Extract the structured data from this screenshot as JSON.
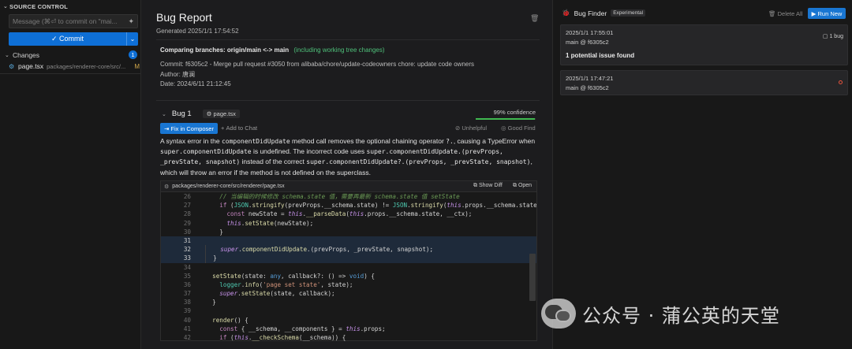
{
  "source_control": {
    "header": "SOURCE CONTROL",
    "message_placeholder": "Message (⌘⏎ to commit on \"mai...",
    "commit_label": "Commit",
    "changes_label": "Changes",
    "changes_count": "1",
    "file_name": "page.tsx",
    "file_path": "packages/renderer-core/src/...",
    "file_status": "M"
  },
  "report": {
    "title": "Bug Report",
    "generated": "Generated 2025/1/1 17:54:52",
    "comparing": "Comparing branches: origin/main <-> main",
    "comparing_note": "(including working tree changes)",
    "commit": "Commit: f6305c2 - Merge pull request #3050 from alibaba/chore/update-codeowners chore: update code owners",
    "author": "Author: 唐澜",
    "date": "Date: 2024/6/11 21:12:45",
    "bug_title": "Bug 1",
    "bug_file": "page.tsx",
    "confidence": "99% confidence",
    "confidence_value": 0.99,
    "fix_label": "Fix in Composer",
    "add_chat_label": "Add to Chat",
    "unhelpful_label": "Unhelpful",
    "good_find_label": "Good Find",
    "desc": {
      "p1": "A syntax error in the ",
      "c1": "componentDidUpdate",
      "p2": " method call removes the optional chaining operator ",
      "c2": "?.",
      "p3": ", causing a TypeError when ",
      "c3": "super.componentDidUpdate",
      "p4": " is undefined. The incorrect code uses ",
      "c4": "super.componentDidUpdate.(prevProps, _prevState, snapshot)",
      "p5": " instead of the correct ",
      "c5": "super.componentDidUpdate?.(prevProps, _prevState, snapshot)",
      "p6": ", which will throw an error if the method is not defined on the superclass."
    },
    "viewer_path": "packages/renderer-core/src/renderer/page.tsx",
    "show_diff_label": "Show Diff",
    "open_label": "Open"
  },
  "code_lines": [
    {
      "n": "26",
      "text": "    // 当编辑的时候修改 schema.state 值，需要再最新 schema.state 值 setState"
    },
    {
      "n": "27",
      "text": "    if (JSON.stringify(prevProps.__schema.state) != JSON.stringify(this.props.__schema.state)) {"
    },
    {
      "n": "28",
      "text": "      const newState = this.__parseData(this.props.__schema.state, __ctx);"
    },
    {
      "n": "29",
      "text": "      this.setState(newState);"
    },
    {
      "n": "30",
      "text": "    }"
    },
    {
      "n": "31",
      "text": ""
    },
    {
      "n": "32",
      "text": "    super.componentDidUpdate.(prevProps, _prevState, snapshot);"
    },
    {
      "n": "33",
      "text": "  }"
    },
    {
      "n": "34",
      "text": ""
    },
    {
      "n": "35",
      "text": "  setState(state: any, callback?: () => void) {"
    },
    {
      "n": "36",
      "text": "    logger.info('page set state', state);"
    },
    {
      "n": "37",
      "text": "    super.setState(state, callback);"
    },
    {
      "n": "38",
      "text": "  }"
    },
    {
      "n": "39",
      "text": ""
    },
    {
      "n": "40",
      "text": "  render() {"
    },
    {
      "n": "41",
      "text": "    const { __schema, __components } = this.props;"
    },
    {
      "n": "42",
      "text": "    if (this.__checkSchema(__schema)) {"
    }
  ],
  "finder": {
    "title": "Bug Finder",
    "badge": "Experimental",
    "delete_all": "Delete All",
    "run_new": "Run New",
    "cards": [
      {
        "timestamp": "2025/1/1 17:55:01",
        "branch": "main @ f6305c2",
        "bugs": "1 bug",
        "summary": "1 potential issue found"
      },
      {
        "timestamp": "2025/1/1 17:47:21",
        "branch": "main @ f6305c2"
      }
    ]
  },
  "watermark": "公众号 · 蒲公英的天堂"
}
